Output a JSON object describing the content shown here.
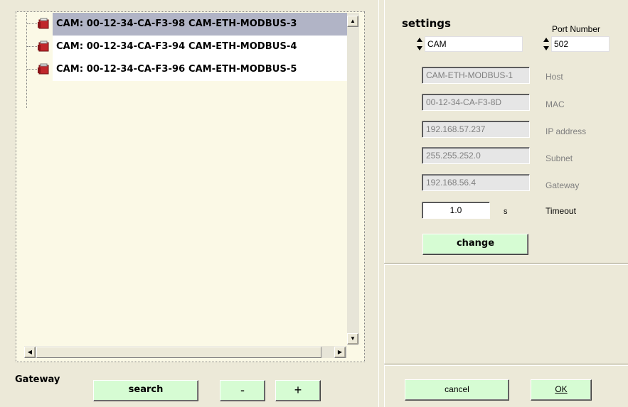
{
  "tree": {
    "items": [
      {
        "label": "CAM: 00-12-34-CA-F3-98 CAM-ETH-MODBUS-3",
        "selected": true
      },
      {
        "label": "CAM: 00-12-34-CA-F3-94 CAM-ETH-MODBUS-4",
        "selected": false
      },
      {
        "label": "CAM: 00-12-34-CA-F3-96 CAM-ETH-MODBUS-5",
        "selected": false
      }
    ]
  },
  "bottom_left": {
    "gateway_label": "Gateway",
    "search_label": "search",
    "minus_label": "-",
    "plus_label": "+"
  },
  "settings": {
    "title": "settings",
    "port_label": "Port Number",
    "name_value": "CAM",
    "port_value": "502",
    "fields": [
      {
        "value": "CAM-ETH-MODBUS-1",
        "label": "Host"
      },
      {
        "value": "00-12-34-CA-F3-8D",
        "label": "MAC"
      },
      {
        "value": "192.168.57.237",
        "label": "IP address"
      },
      {
        "value": "255.255.252.0",
        "label": "Subnet"
      },
      {
        "value": "192.168.56.4",
        "label": "Gateway"
      }
    ],
    "timeout_value": "1.0",
    "timeout_unit": "s",
    "timeout_label": "Timeout",
    "change_label": "change"
  },
  "dialog": {
    "cancel_label": "cancel",
    "ok_label": "OK"
  },
  "colors": {
    "background": "#ece9d8",
    "tree_background": "#fbf9e6",
    "selected_row": "#b1b4c6",
    "green_button": "#d6fcd3"
  }
}
